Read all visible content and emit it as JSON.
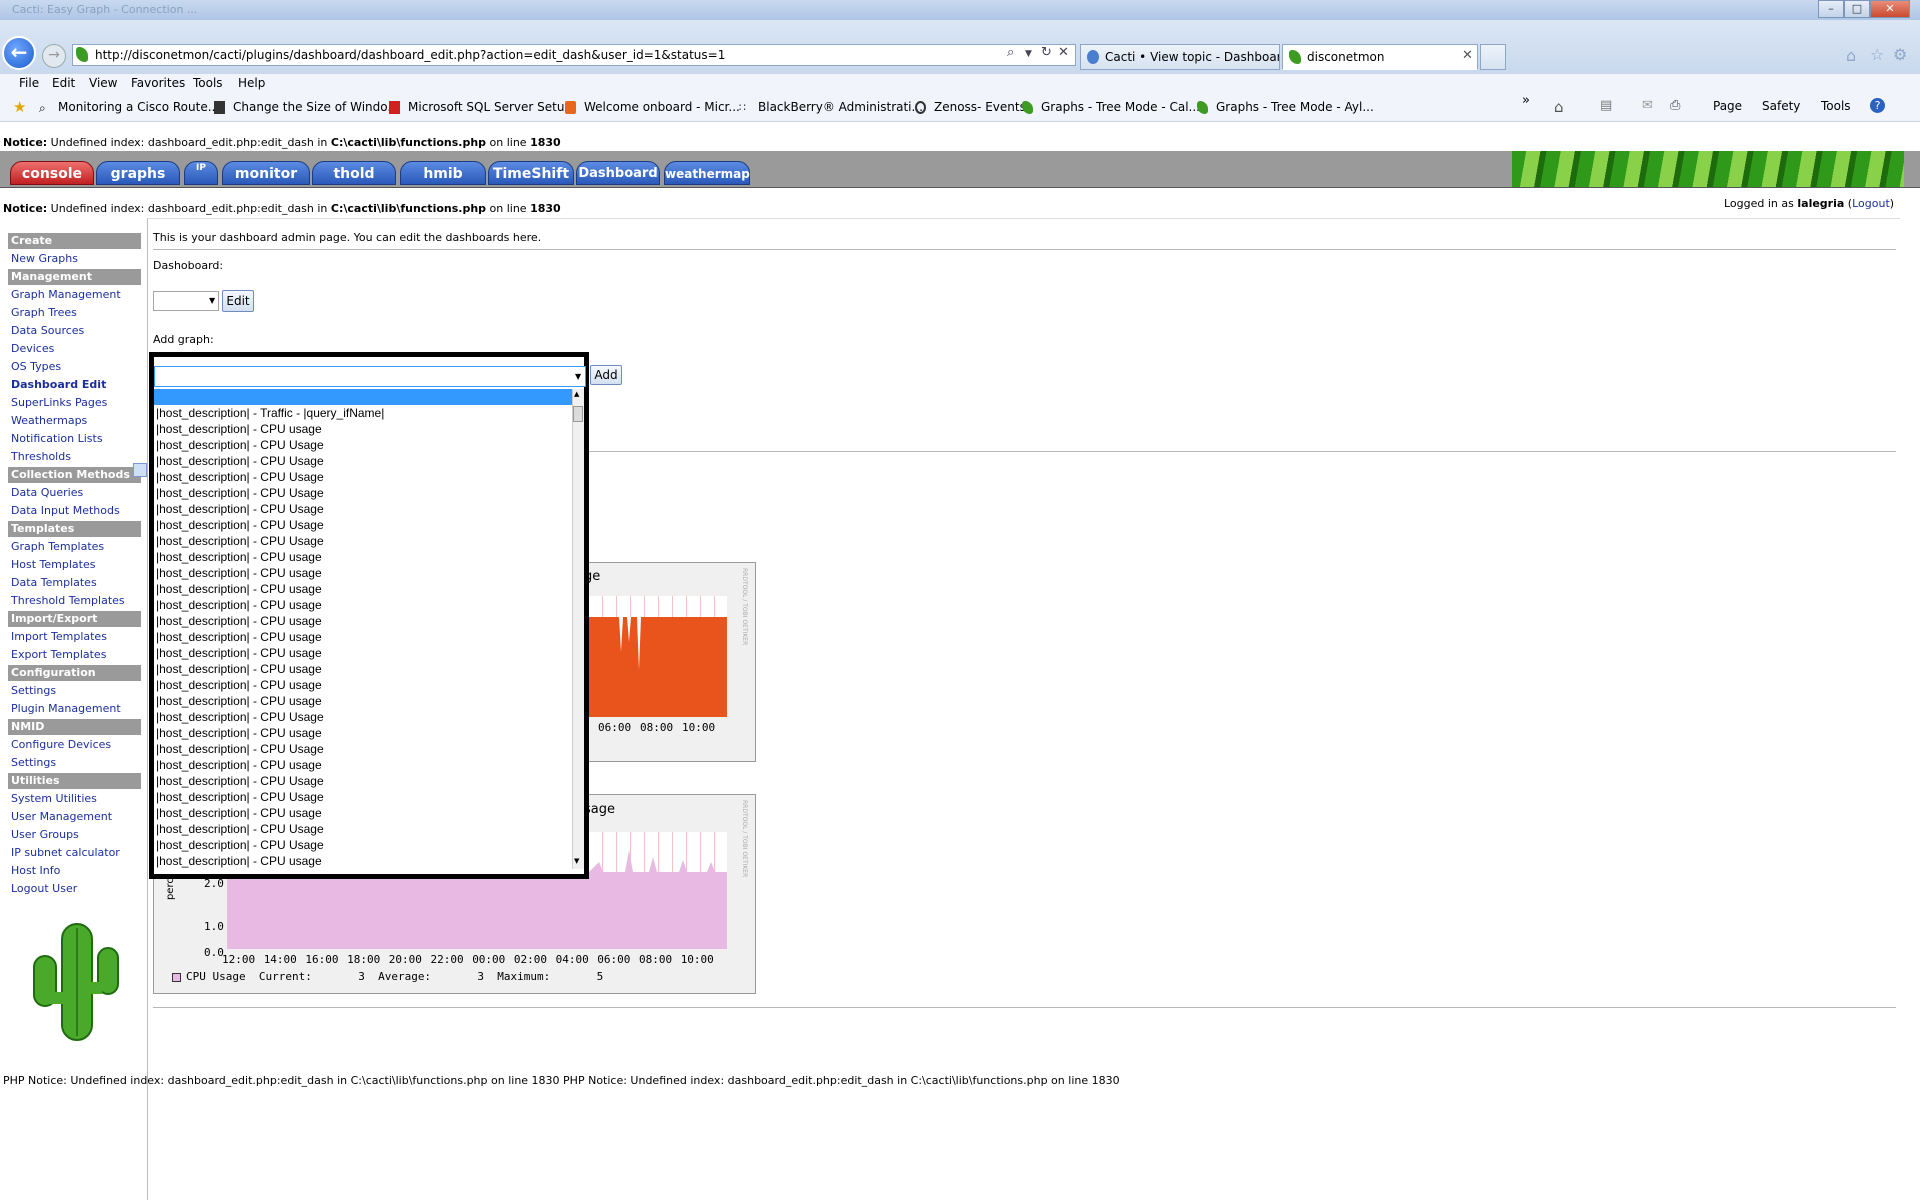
{
  "window": {
    "title_text": "Cacti: Easy Graph - Connection ...",
    "minimize": "–",
    "maximize": "□",
    "close": "✕"
  },
  "browser": {
    "address": "http://disconetmon/cacti/plugins/dashboard/dashboard_edit.php?action=edit_dash&user_id=1&status=1",
    "tabs": [
      {
        "label": "Cacti • View topic - Dashboard...",
        "active": false
      },
      {
        "label": "disconetmon",
        "active": true
      }
    ],
    "menu": [
      "File",
      "Edit",
      "View",
      "Favorites",
      "Tools",
      "Help"
    ],
    "favorites": [
      "Monitoring a Cisco Route...",
      "Change the Size of Windo...",
      "Microsoft SQL Server Setu...",
      "Welcome onboard - Micr...",
      "BlackBerry® Administrati...",
      "Zenoss- Events",
      "Graphs - Tree Mode - Cal...",
      "Graphs - Tree Mode - Ayl..."
    ],
    "command_bar": [
      "Page",
      "Safety",
      "Tools"
    ],
    "overflow": "»"
  },
  "notices": {
    "top": {
      "prefix": "Notice:",
      "text": " Undefined index: dashboard_edit.php:edit_dash in ",
      "path": "C:\\cacti\\lib\\functions.php",
      "mid": " on line ",
      "line": "1830"
    },
    "under_nav": {
      "prefix": "Notice:",
      "text": " Undefined index: dashboard_edit.php:edit_dash in ",
      "path": "C:\\cacti\\lib\\functions.php",
      "mid": " on line ",
      "line": "1830"
    },
    "php_footer": "PHP Notice: Undefined index: dashboard_edit.php:edit_dash in C:\\cacti\\lib\\functions.php on line 1830 PHP Notice: Undefined index: dashboard_edit.php:edit_dash in C:\\cacti\\lib\\functions.php on line 1830"
  },
  "cacti_tabs": [
    "console",
    "graphs",
    "IP",
    "monitor",
    "thold",
    "hmib",
    "TimeShift",
    "Dashboard",
    "weathermap"
  ],
  "login": {
    "prefix": "Logged in as ",
    "user": "lalegria",
    "logout": "Logout"
  },
  "sidebar": [
    {
      "type": "head",
      "label": "Create"
    },
    {
      "type": "item",
      "label": "New Graphs"
    },
    {
      "type": "head",
      "label": "Management"
    },
    {
      "type": "item",
      "label": "Graph Management"
    },
    {
      "type": "item",
      "label": "Graph Trees"
    },
    {
      "type": "item",
      "label": "Data Sources"
    },
    {
      "type": "item",
      "label": "Devices"
    },
    {
      "type": "item",
      "label": "OS Types"
    },
    {
      "type": "item",
      "label": "Dashboard Edit",
      "bold": true
    },
    {
      "type": "item",
      "label": "SuperLinks Pages"
    },
    {
      "type": "item",
      "label": "Weathermaps"
    },
    {
      "type": "item",
      "label": "Notification Lists"
    },
    {
      "type": "item",
      "label": "Thresholds"
    },
    {
      "type": "head",
      "label": "Collection Methods"
    },
    {
      "type": "item",
      "label": "Data Queries"
    },
    {
      "type": "item",
      "label": "Data Input Methods"
    },
    {
      "type": "head",
      "label": "Templates"
    },
    {
      "type": "item",
      "label": "Graph Templates"
    },
    {
      "type": "item",
      "label": "Host Templates"
    },
    {
      "type": "item",
      "label": "Data Templates"
    },
    {
      "type": "item",
      "label": "Threshold Templates"
    },
    {
      "type": "head",
      "label": "Import/Export"
    },
    {
      "type": "item",
      "label": "Import Templates"
    },
    {
      "type": "item",
      "label": "Export Templates"
    },
    {
      "type": "head",
      "label": "Configuration"
    },
    {
      "type": "item",
      "label": "Settings"
    },
    {
      "type": "item",
      "label": "Plugin Management"
    },
    {
      "type": "head",
      "label": "NMID"
    },
    {
      "type": "item",
      "label": "Configure Devices"
    },
    {
      "type": "item",
      "label": "Settings"
    },
    {
      "type": "head",
      "label": "Utilities"
    },
    {
      "type": "item",
      "label": "System Utilities"
    },
    {
      "type": "item",
      "label": "User Management"
    },
    {
      "type": "item",
      "label": "User Groups"
    },
    {
      "type": "item",
      "label": "IP subnet calculator"
    },
    {
      "type": "item",
      "label": "Host Info"
    },
    {
      "type": "item",
      "label": "Logout User"
    }
  ],
  "main": {
    "intro": "This is your dashboard admin page. You can edit the dashboards here.",
    "dashboard_label": "Dashoboard:",
    "edit_button": "Edit",
    "add_graph_label": "Add graph:",
    "add_button": "Add",
    "dropdown_options": [
      "",
      "|host_description| - Traffic - |query_ifName|",
      "|host_description| - CPU usage",
      "|host_description| - CPU Usage",
      "|host_description| - CPU Usage",
      "|host_description| - CPU Usage",
      "|host_description| - CPU Usage",
      "|host_description| - CPU Usage",
      "|host_description| - CPU Usage",
      "|host_description| - CPU Usage",
      "|host_description| - CPU usage",
      "|host_description| - CPU usage",
      "|host_description| - CPU usage",
      "|host_description| - CPU usage",
      "|host_description| - CPU usage",
      "|host_description| - CPU usage",
      "|host_description| - CPU usage",
      "|host_description| - CPU usage",
      "|host_description| - CPU usage",
      "|host_description| - CPU usage",
      "|host_description| - CPU Usage",
      "|host_description| - CPU usage",
      "|host_description| - CPU Usage",
      "|host_description| - CPU usage",
      "|host_description| - CPU Usage",
      "|host_description| - CPU Usage",
      "|host_description| - CPU usage",
      "|host_description| - CPU Usage",
      "|host_description| - CPU Usage",
      "|host_description| - CPU usage"
    ],
    "graph1": {
      "title_fragment": "ge",
      "ticks": [
        "06:00",
        "08:00",
        "10:00"
      ],
      "watermark": "RRDTOOL / TOBI OETIKER"
    },
    "graph2": {
      "title_fragment": "sage",
      "ylabel_fragment": "perce",
      "yticks": [
        "0.0",
        "1.0",
        "2.0"
      ],
      "xticks": [
        "12:00",
        "14:00",
        "16:00",
        "18:00",
        "20:00",
        "22:00",
        "00:00",
        "02:00",
        "04:00",
        "06:00",
        "08:00",
        "10:00"
      ],
      "legend": {
        "name": "CPU Usage",
        "current_label": "Current:",
        "current": "3",
        "average_label": "Average:",
        "average": "3",
        "maximum_label": "Maximum:",
        "maximum": "5"
      },
      "watermark": "RRDTOOL / TOBI OETIKER"
    }
  },
  "colors": {
    "nav_bar": "#9a9a9a",
    "console_tab": "#d03030",
    "tab_blue": "#3366cc",
    "link": "#1b2e9c",
    "selection": "#3399ff",
    "graph1_fill": "#e8541c",
    "graph2_fill": "#e8b9e2"
  }
}
